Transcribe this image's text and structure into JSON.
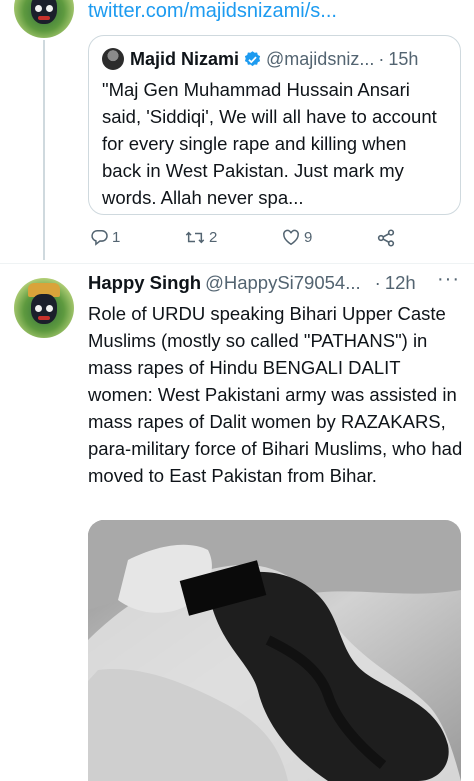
{
  "previous_tweet": {
    "link_text": "twitter.com/majidsnizami/s...",
    "quoted_tweet": {
      "author_name": "Majid Nizami",
      "handle": "@majidsniz...",
      "separator": "·",
      "time": "15h",
      "text": "\"Maj Gen Muhammad Hussain Ansari said, 'Siddiqi', We will all have to account for every single rape and killing when back in West Pakistan. Just mark my words. Allah never spa..."
    },
    "actions": {
      "replies": "1",
      "retweets": "2",
      "likes": "9"
    }
  },
  "tweet": {
    "author_name": "Happy Singh",
    "handle": "@HappySi79054...",
    "separator": "·",
    "time": "12h",
    "text": "Role of URDU speaking Bihari Upper Caste Muslims (mostly so called \"PATHANS\") in mass rapes of Hindu BENGALI DALIT women: West Pakistani army was assisted in mass rapes of Dalit women by RAZAKARS, para-military force of Bihari Muslims, who had moved to East Pakistan from Bihar."
  },
  "colors": {
    "link": "#1d9bf0",
    "secondary_text": "#536471",
    "border": "#cfd9de",
    "verified": "#1d9bf0"
  },
  "icons": [
    "reply-icon",
    "retweet-icon",
    "like-icon",
    "share-icon",
    "verified-badge-icon",
    "more-icon"
  ]
}
